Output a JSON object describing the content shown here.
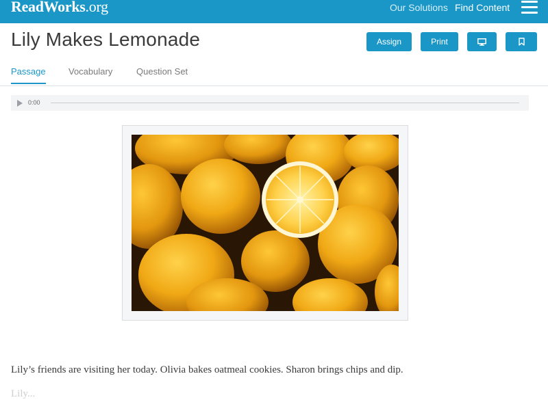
{
  "nav": {
    "logo_main": "ReadWorks",
    "logo_suffix": ".org",
    "links": [
      "Our Solutions",
      "Find Content"
    ],
    "menu_icon": "hamburger-icon"
  },
  "colors": {
    "brand": "#1a97c7",
    "text": "#3a3a3a"
  },
  "page": {
    "title": "Lily Makes Lemonade",
    "actions": {
      "assign": "Assign",
      "print": "Print",
      "present_icon": "monitor-icon",
      "bookmark_icon": "bookmark-icon"
    }
  },
  "tabs": [
    {
      "label": "Passage",
      "active": true
    },
    {
      "label": "Vocabulary",
      "active": false
    },
    {
      "label": "Question Set",
      "active": false
    }
  ],
  "audio": {
    "time": "0:00",
    "icon": "play-icon"
  },
  "passage": {
    "image_subject": "lemons",
    "first_line": "Lily’s friends are visiting her today. Olivia bakes oatmeal cookies. Sharon brings chips and dip.",
    "next_line_start": "Lily..."
  }
}
